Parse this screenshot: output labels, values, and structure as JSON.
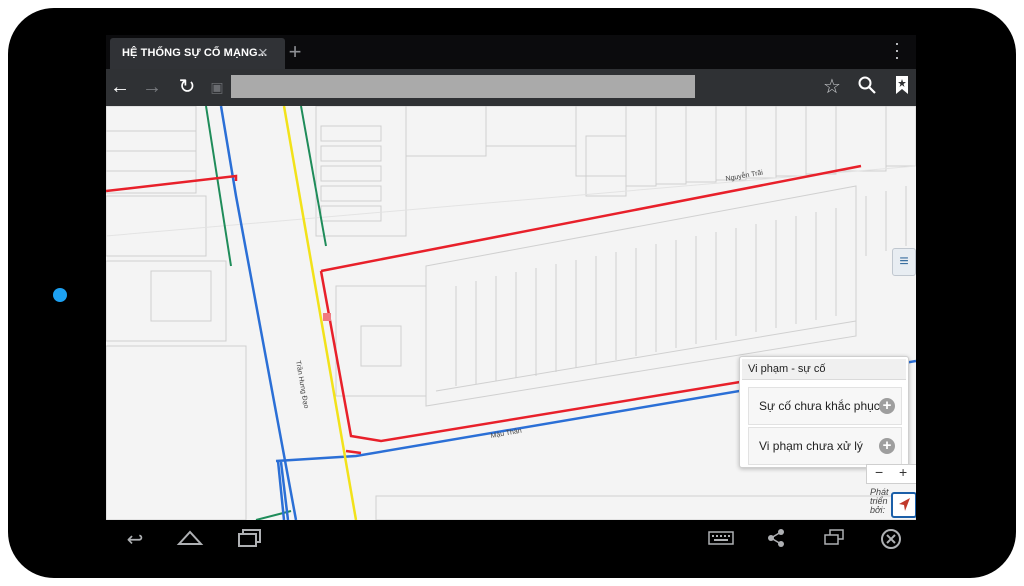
{
  "browser": {
    "tab_title": "HỆ THỐNG SỰ CỐ MẠNG...",
    "tab_close_icon": "close-icon",
    "new_tab_icon": "plus-icon",
    "menu_icon": "overflow-menu-icon",
    "url": "",
    "toolbar_icons": [
      "back-arrow-icon",
      "forward-arrow-icon",
      "reload-icon",
      "page-icon",
      "star-icon",
      "search-icon",
      "bookmark-icon"
    ]
  },
  "map": {
    "street_labels": {
      "nguyen_trai": "Nguyễn Trãi",
      "tran_hung_dao": "Trần Hưng Đạo",
      "mau_than": "Mậu Thân"
    },
    "colors": {
      "red_network": "#e8202a",
      "blue_network": "#2b6fd6",
      "yellow_road": "#f2e21a",
      "green_line": "#1f8c5a"
    }
  },
  "panel": {
    "title": "Vi phạm - sự cố",
    "items": [
      {
        "label": "Sự cố chưa khắc phục",
        "icon": "plus-circle-icon"
      },
      {
        "label": "Vi phạm chưa xử lý",
        "icon": "plus-circle-icon"
      }
    ]
  },
  "controls": {
    "report_label": "Phát triển bởi:",
    "zoom_out": "−",
    "zoom_in": "+"
  },
  "android_nav": {
    "icons": [
      "back-icon",
      "home-icon",
      "recent-apps-icon",
      "keyboard-icon",
      "share-icon",
      "window-icon",
      "close-circle-icon"
    ]
  }
}
